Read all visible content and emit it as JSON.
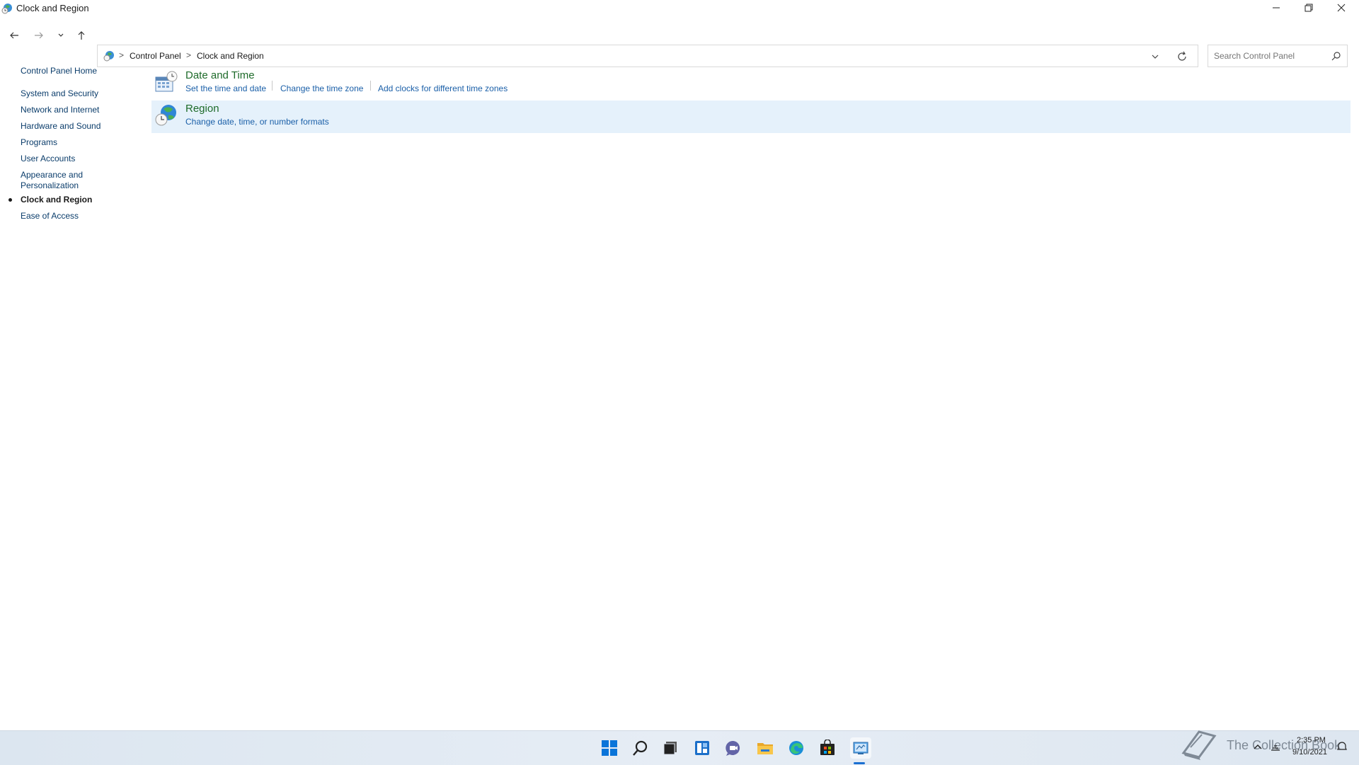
{
  "window": {
    "title": "Clock and Region"
  },
  "address": {
    "crumbs": [
      "Control Panel",
      "Clock and Region"
    ],
    "separator": ">"
  },
  "search": {
    "placeholder": "Search Control Panel"
  },
  "sidebar": {
    "home": "Control Panel Home",
    "items": [
      {
        "label": "System and Security"
      },
      {
        "label": "Network and Internet"
      },
      {
        "label": "Hardware and Sound"
      },
      {
        "label": "Programs"
      },
      {
        "label": "User Accounts"
      },
      {
        "label": "Appearance and"
      },
      {
        "label": "Personalization"
      },
      {
        "label": "Clock and Region",
        "active": true
      },
      {
        "label": "Ease of Access"
      }
    ]
  },
  "categories": [
    {
      "title": "Date and Time",
      "icon": "calendar-clock-icon",
      "links": [
        "Set the time and date",
        "Change the time zone",
        "Add clocks for different time zones"
      ]
    },
    {
      "title": "Region",
      "icon": "globe-clock-icon",
      "links": [
        "Change date, time, or number formats"
      ],
      "highlighted": true
    }
  ],
  "taskbar": {
    "apps": [
      "start-icon",
      "search-icon",
      "task-view-icon",
      "widgets-icon",
      "chat-icon",
      "file-explorer-icon",
      "edge-icon",
      "store-icon",
      "control-panel-icon"
    ],
    "watermark": "The Collection Book",
    "time": "2:35 PM",
    "date": "9/10/2021"
  },
  "colors": {
    "link": "#1a5fa8",
    "category_title": "#1e6b2a",
    "highlight": "#e5f1fb",
    "taskbar": "#e0e8f1"
  }
}
